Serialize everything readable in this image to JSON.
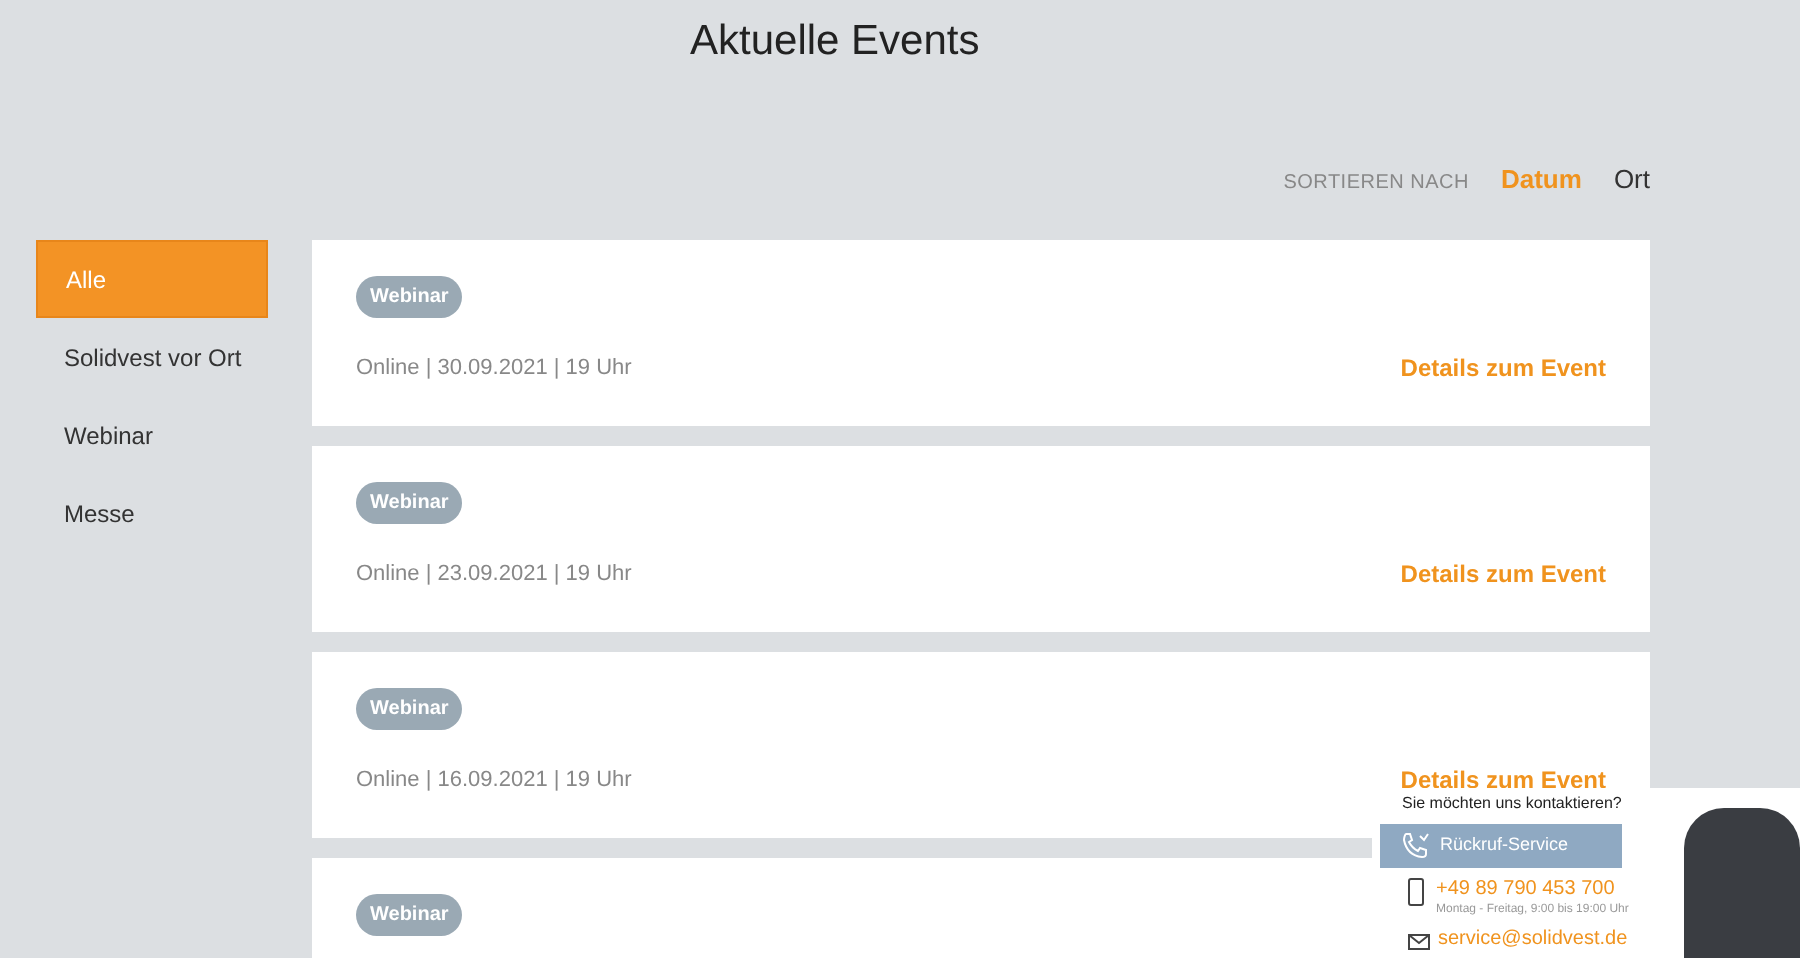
{
  "page_title": "Aktuelle Events",
  "sort": {
    "label": "SORTIEREN NACH",
    "options": [
      {
        "label": "Datum",
        "selected": true
      },
      {
        "label": "Ort",
        "selected": false
      }
    ]
  },
  "filters": [
    {
      "label": "Alle",
      "selected": true
    },
    {
      "label": "Solidvest vor Ort",
      "selected": false
    },
    {
      "label": "Webinar",
      "selected": false
    },
    {
      "label": "Messe",
      "selected": false
    }
  ],
  "events": [
    {
      "tag": "Webinar",
      "info": "Online | 30.09.2021 | 19 Uhr",
      "link": "Details zum Event"
    },
    {
      "tag": "Webinar",
      "info": "Online | 23.09.2021 | 19 Uhr",
      "link": "Details zum Event"
    },
    {
      "tag": "Webinar",
      "info": "Online | 16.09.2021 | 19 Uhr",
      "link": "Details zum Event"
    },
    {
      "tag": "Webinar"
    }
  ],
  "contact": {
    "title": "Sie möchten uns kontaktieren?",
    "callback_button": "Rückruf-Service",
    "phone": "+49 89 790 453 700",
    "hours": "Montag - Freitag, 9:00 bis 19:00 Uhr",
    "email": "service@solidvest.de"
  }
}
